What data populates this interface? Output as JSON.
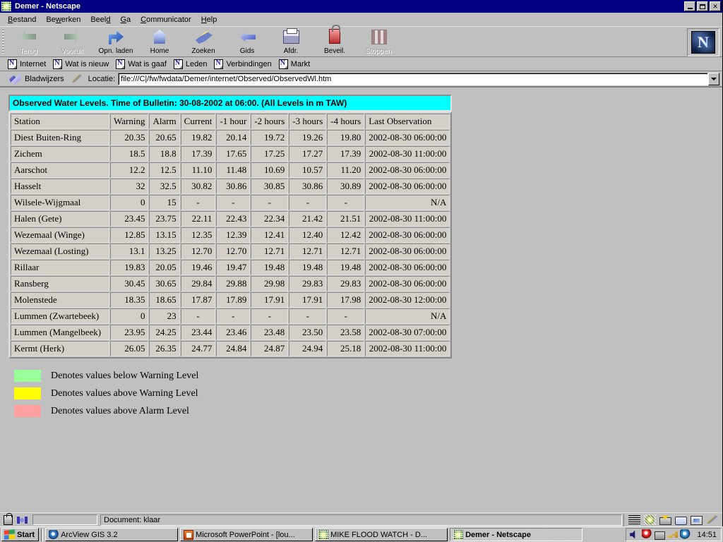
{
  "window": {
    "title": "Demer - Netscape",
    "icon": "netscape-document-icon",
    "minimize_label": "Minimize",
    "restore_label": "Restore",
    "close_label": "Close"
  },
  "menubar": {
    "items": [
      {
        "label": "Bestand",
        "accel": "B"
      },
      {
        "label": "Bewerken",
        "accel": "w"
      },
      {
        "label": "Beeld",
        "accel": "d"
      },
      {
        "label": "Ga",
        "accel": "G"
      },
      {
        "label": "Communicator",
        "accel": "C"
      },
      {
        "label": "Help",
        "accel": "H"
      }
    ]
  },
  "navbar": {
    "buttons": [
      {
        "label": "Terug",
        "icon": "back-arrow-icon",
        "disabled": true
      },
      {
        "label": "Vooruit",
        "icon": "forward-arrow-icon",
        "disabled": true
      },
      {
        "label": "Opn. laden",
        "icon": "reload-icon",
        "disabled": false
      },
      {
        "label": "Home",
        "icon": "home-icon",
        "disabled": false
      },
      {
        "label": "Zoeken",
        "icon": "search-icon",
        "disabled": false
      },
      {
        "label": "Gids",
        "icon": "guide-icon",
        "disabled": false
      },
      {
        "label": "Afdr.",
        "icon": "print-icon",
        "disabled": false
      },
      {
        "label": "Beveil.",
        "icon": "security-lock-icon",
        "disabled": false
      },
      {
        "label": "Stoppen",
        "icon": "stop-icon",
        "disabled": true
      }
    ],
    "logo_letter": "N"
  },
  "linkbar": {
    "items": [
      {
        "label": "Internet"
      },
      {
        "label": "Wat is nieuw"
      },
      {
        "label": "Wat is gaaf"
      },
      {
        "label": "Leden"
      },
      {
        "label": "Verbindingen"
      },
      {
        "label": "Markt"
      }
    ]
  },
  "locationbar": {
    "bookmarks_label": "Bladwijzers",
    "location_label": "Locatie:",
    "url": "file:///C|/fw/fwdata/Demer/internet/Observed/ObservedWl.htm",
    "url_placeholder": "Locatie"
  },
  "page": {
    "table": {
      "caption": "Observed Water Levels. Time of Bulletin: 30-08-2002 at 06:00. (All Levels in m TAW)",
      "columns": [
        "Station",
        "Warning",
        "Alarm",
        "Current",
        "-1 hour",
        "-2 hours",
        "-3 hours",
        "-4 hours",
        "Last Observation"
      ],
      "rows": [
        {
          "station": "Diest Buiten-Ring",
          "warning": "20.35",
          "alarm": "20.65",
          "cells": [
            {
              "v": "19.82",
              "s": "green"
            },
            {
              "v": "20.14",
              "s": "green"
            },
            {
              "v": "19.72",
              "s": "green"
            },
            {
              "v": "19.26",
              "s": "green"
            },
            {
              "v": "19.80",
              "s": "green"
            }
          ],
          "last": "2002-08-30 06:00:00"
        },
        {
          "station": "Zichem",
          "warning": "18.5",
          "alarm": "18.8",
          "cells": [
            {
              "v": "17.39",
              "s": "green"
            },
            {
              "v": "17.65",
              "s": "green"
            },
            {
              "v": "17.25",
              "s": "green"
            },
            {
              "v": "17.27",
              "s": "green"
            },
            {
              "v": "17.39",
              "s": "green"
            }
          ],
          "last": "2002-08-30 11:00:00"
        },
        {
          "station": "Aarschot",
          "warning": "12.2",
          "alarm": "12.5",
          "cells": [
            {
              "v": "11.10",
              "s": "green"
            },
            {
              "v": "11.48",
              "s": "green"
            },
            {
              "v": "10.69",
              "s": "green"
            },
            {
              "v": "10.57",
              "s": "green"
            },
            {
              "v": "11.20",
              "s": "green"
            }
          ],
          "last": "2002-08-30 06:00:00"
        },
        {
          "station": "Hasselt",
          "warning": "32",
          "alarm": "32.5",
          "cells": [
            {
              "v": "30.82",
              "s": "green"
            },
            {
              "v": "30.86",
              "s": "green"
            },
            {
              "v": "30.85",
              "s": "green"
            },
            {
              "v": "30.86",
              "s": "green"
            },
            {
              "v": "30.89",
              "s": "green"
            }
          ],
          "last": "2002-08-30 06:00:00"
        },
        {
          "station": "Wilsele-Wijgmaal",
          "warning": "0",
          "alarm": "15",
          "cells": [
            {
              "v": "-",
              "s": "dash"
            },
            {
              "v": "-",
              "s": "dash"
            },
            {
              "v": "-",
              "s": "dash"
            },
            {
              "v": "-",
              "s": "dash"
            },
            {
              "v": "-",
              "s": "dash"
            }
          ],
          "last": "N/A"
        },
        {
          "station": "Halen (Gete)",
          "warning": "23.45",
          "alarm": "23.75",
          "cells": [
            {
              "v": "22.11",
              "s": "green"
            },
            {
              "v": "22.43",
              "s": "green"
            },
            {
              "v": "22.34",
              "s": "green"
            },
            {
              "v": "21.42",
              "s": "green"
            },
            {
              "v": "21.51",
              "s": "green"
            }
          ],
          "last": "2002-08-30 11:00:00"
        },
        {
          "station": "Wezemaal (Winge)",
          "warning": "12.85",
          "alarm": "13.15",
          "cells": [
            {
              "v": "12.35",
              "s": "green"
            },
            {
              "v": "12.39",
              "s": "green"
            },
            {
              "v": "12.41",
              "s": "green"
            },
            {
              "v": "12.40",
              "s": "green"
            },
            {
              "v": "12.42",
              "s": "green"
            }
          ],
          "last": "2002-08-30 06:00:00"
        },
        {
          "station": "Wezemaal (Losting)",
          "warning": "13.1",
          "alarm": "13.25",
          "cells": [
            {
              "v": "12.70",
              "s": "green"
            },
            {
              "v": "12.70",
              "s": "green"
            },
            {
              "v": "12.71",
              "s": "green"
            },
            {
              "v": "12.71",
              "s": "green"
            },
            {
              "v": "12.71",
              "s": "green"
            }
          ],
          "last": "2002-08-30 06:00:00"
        },
        {
          "station": "Rillaar",
          "warning": "19.83",
          "alarm": "20.05",
          "cells": [
            {
              "v": "19.46",
              "s": "green"
            },
            {
              "v": "19.47",
              "s": "green"
            },
            {
              "v": "19.48",
              "s": "green"
            },
            {
              "v": "19.48",
              "s": "green"
            },
            {
              "v": "19.48",
              "s": "green"
            }
          ],
          "last": "2002-08-30 06:00:00"
        },
        {
          "station": "Ransberg",
          "warning": "30.45",
          "alarm": "30.65",
          "cells": [
            {
              "v": "29.84",
              "s": "green"
            },
            {
              "v": "29.88",
              "s": "green"
            },
            {
              "v": "29.98",
              "s": "green"
            },
            {
              "v": "29.83",
              "s": "green"
            },
            {
              "v": "29.83",
              "s": "green"
            }
          ],
          "last": "2002-08-30 06:00:00"
        },
        {
          "station": "Molenstede",
          "warning": "18.35",
          "alarm": "18.65",
          "cells": [
            {
              "v": "17.87",
              "s": "green"
            },
            {
              "v": "17.89",
              "s": "green"
            },
            {
              "v": "17.91",
              "s": "green"
            },
            {
              "v": "17.91",
              "s": "green"
            },
            {
              "v": "17.98",
              "s": "green"
            }
          ],
          "last": "2002-08-30 12:00:00"
        },
        {
          "station": "Lummen (Zwartebeek)",
          "warning": "0",
          "alarm": "23",
          "cells": [
            {
              "v": "-",
              "s": "dash"
            },
            {
              "v": "-",
              "s": "dash"
            },
            {
              "v": "-",
              "s": "dash"
            },
            {
              "v": "-",
              "s": "dash"
            },
            {
              "v": "-",
              "s": "dash"
            }
          ],
          "last": "N/A"
        },
        {
          "station": "Lummen (Mangelbeek)",
          "warning": "23.95",
          "alarm": "24.25",
          "cells": [
            {
              "v": "23.44",
              "s": "green"
            },
            {
              "v": "23.46",
              "s": "green"
            },
            {
              "v": "23.48",
              "s": "green"
            },
            {
              "v": "23.50",
              "s": "green"
            },
            {
              "v": "23.58",
              "s": "green"
            }
          ],
          "last": "2002-08-30 07:00:00"
        },
        {
          "station": "Kermt (Herk)",
          "warning": "26.05",
          "alarm": "26.35",
          "cells": [
            {
              "v": "24.77",
              "s": "green"
            },
            {
              "v": "24.84",
              "s": "green"
            },
            {
              "v": "24.87",
              "s": "green"
            },
            {
              "v": "24.94",
              "s": "green"
            },
            {
              "v": "25.18",
              "s": "green"
            }
          ],
          "last": "2002-08-30 11:00:00"
        }
      ]
    },
    "legend": [
      {
        "color": "#99ff99",
        "text": "Denotes values below Warning Level"
      },
      {
        "color": "#ffff00",
        "text": "Denotes values above Warning Level"
      },
      {
        "color": "#ff9f9f",
        "text": "Denotes values above Alarm Level"
      }
    ]
  },
  "statusbar": {
    "text": "Document: klaar",
    "component_icons": [
      "grip-icon",
      "navigator-icon",
      "mailbox-icon",
      "discussions-icon",
      "composer-icon",
      "conference-icon"
    ]
  },
  "taskbar": {
    "start_label": "Start",
    "tasks": [
      {
        "label": "ArcView GIS 3.2",
        "icon": "arcview-icon",
        "active": false
      },
      {
        "label": "Microsoft PowerPoint - [lou...",
        "icon": "powerpoint-icon",
        "active": false
      },
      {
        "label": "MIKE FLOOD WATCH - D...",
        "icon": "mikeflood-icon",
        "active": false
      },
      {
        "label": "Demer - Netscape",
        "icon": "netscape-icon",
        "active": true
      }
    ],
    "tray_icons": [
      "speaker-icon",
      "globe-red-icon",
      "network-icon",
      "key-icon",
      "globe-blue-icon"
    ],
    "clock": "14:51"
  },
  "colors": {
    "desktop": "#008080",
    "titlebar": "#000080",
    "face": "#c0c0c0",
    "caption_bg": "#00ffff",
    "green": "#99ff99",
    "yellow": "#ffff00",
    "pink": "#ff9f9f",
    "cell_bg": "#d4d0c8"
  }
}
